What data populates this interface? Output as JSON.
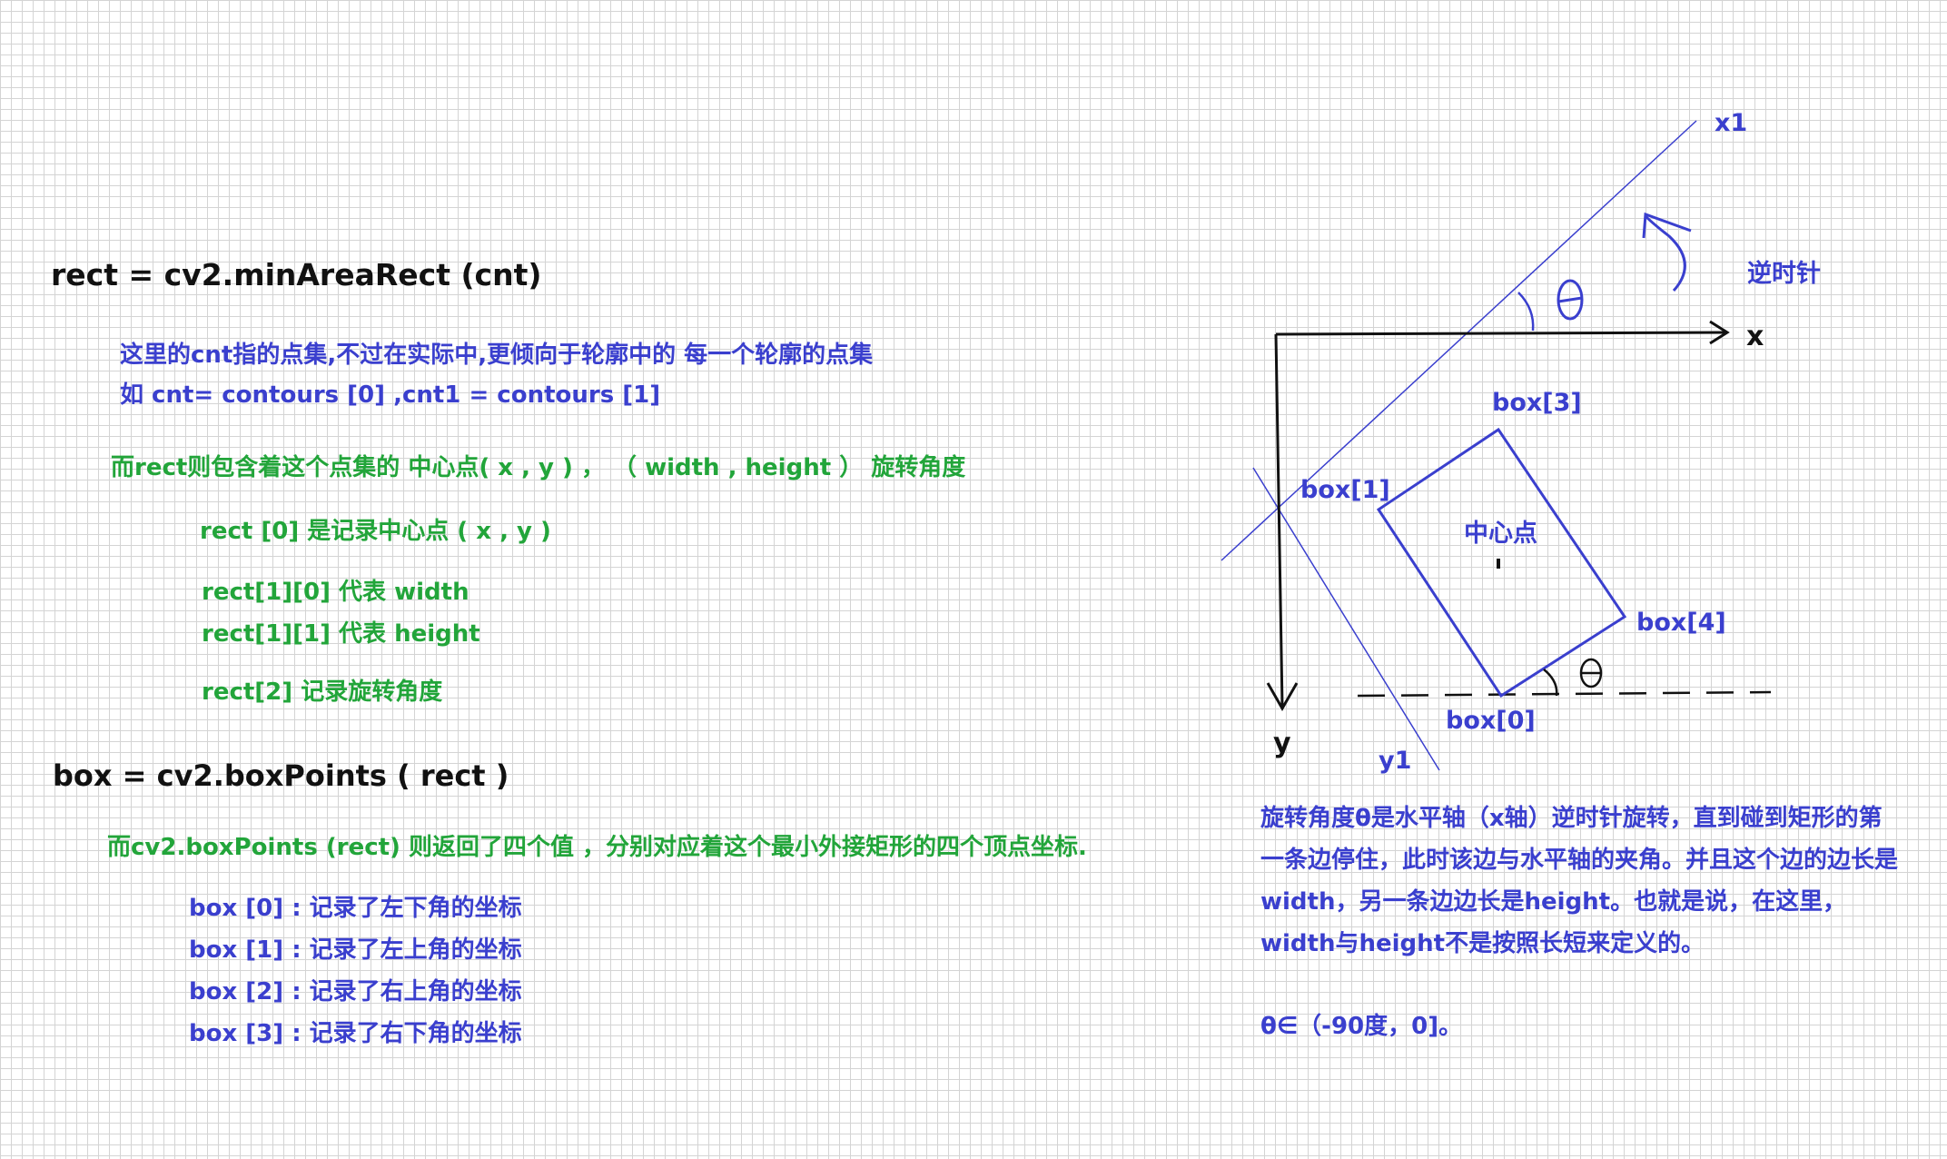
{
  "left": {
    "title1": "rect = cv2.minAreaRect  (cnt)",
    "desc1": "这里的cnt指的点集,不过在实际中,更倾向于轮廓中的 每一个轮廓的点集",
    "desc2": "如 cnt=  contours [0]  ,cnt1 = contours [1]",
    "rect_desc": "而rect则包含着这个点集的   中心点( x , y ) ，  （ width , height ）  旋转角度",
    "rect_items": [
      "rect [0]   是记录中心点 ( x , y )",
      "rect[1][0]   代表  width",
      "rect[1][1]   代表   height",
      "rect[2]        记录旋转角度"
    ],
    "title2": "box = cv2.boxPoints ( rect )",
    "box_desc": "而cv2.boxPoints (rect)  则返回了四个值 ，分别对应着这个最小外接矩形的四个顶点坐标.",
    "box_items": [
      "box [0] : 记录了左下角的坐标",
      "box [1] : 记录了左上角的坐标",
      "box [2] : 记录了右上角的坐标",
      "box [3] : 记录了右下角的坐标"
    ]
  },
  "diagram": {
    "x1": "x1",
    "ccw": "逆时针",
    "x": "x",
    "y": "y",
    "y1": "y1",
    "box0": "box[0]",
    "box1": "box[1]",
    "box3": "box[3]",
    "box4": "box[4]",
    "center": "中心点",
    "note": "旋转角度θ是水平轴（x轴）逆时针旋转，直到碰到矩形的第一条边停住，此时该边与水平轴的夹角。并且这个边的边长是width，另一条边边长是height。也就是说，在这里，width与height不是按照长短来定义的。",
    "range": "θ∈（-90度，0]。"
  },
  "colors": {
    "blue": "#3a3fce",
    "green": "#22a53a",
    "black": "#111111"
  }
}
